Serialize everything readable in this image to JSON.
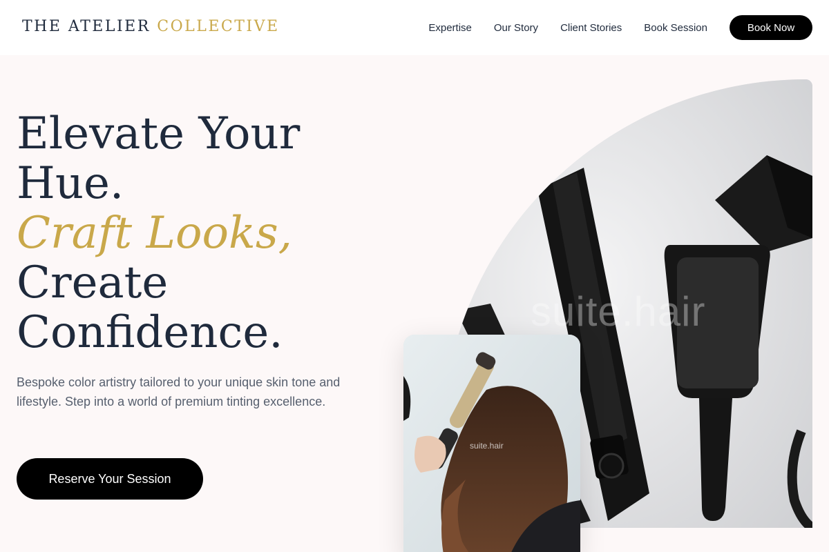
{
  "brand": {
    "name_primary": "THE ATELIER",
    "name_accent": "COLLECTIVE"
  },
  "nav": {
    "links": [
      "Expertise",
      "Our Story",
      "Client Stories",
      "Book Session"
    ],
    "cta": "Book Now"
  },
  "hero": {
    "title_line1": "Elevate Your",
    "title_line2": "Hue.",
    "title_accent": "Craft Looks,",
    "title_line4": "Create",
    "title_line5": "Confidence.",
    "description": "Bespoke color artistry tailored to your unique skin tone and lifestyle. Step into a world of premium tinting excellence.",
    "cta": "Reserve Your Session"
  },
  "images": {
    "main_watermark": "suite.hair",
    "card_watermark": "suite.hair"
  },
  "colors": {
    "accent": "#c9a84a",
    "text_dark": "#1f2a3c",
    "text_muted": "#565f6e",
    "button_bg": "#000000",
    "page_bg": "#fdf8f8"
  }
}
